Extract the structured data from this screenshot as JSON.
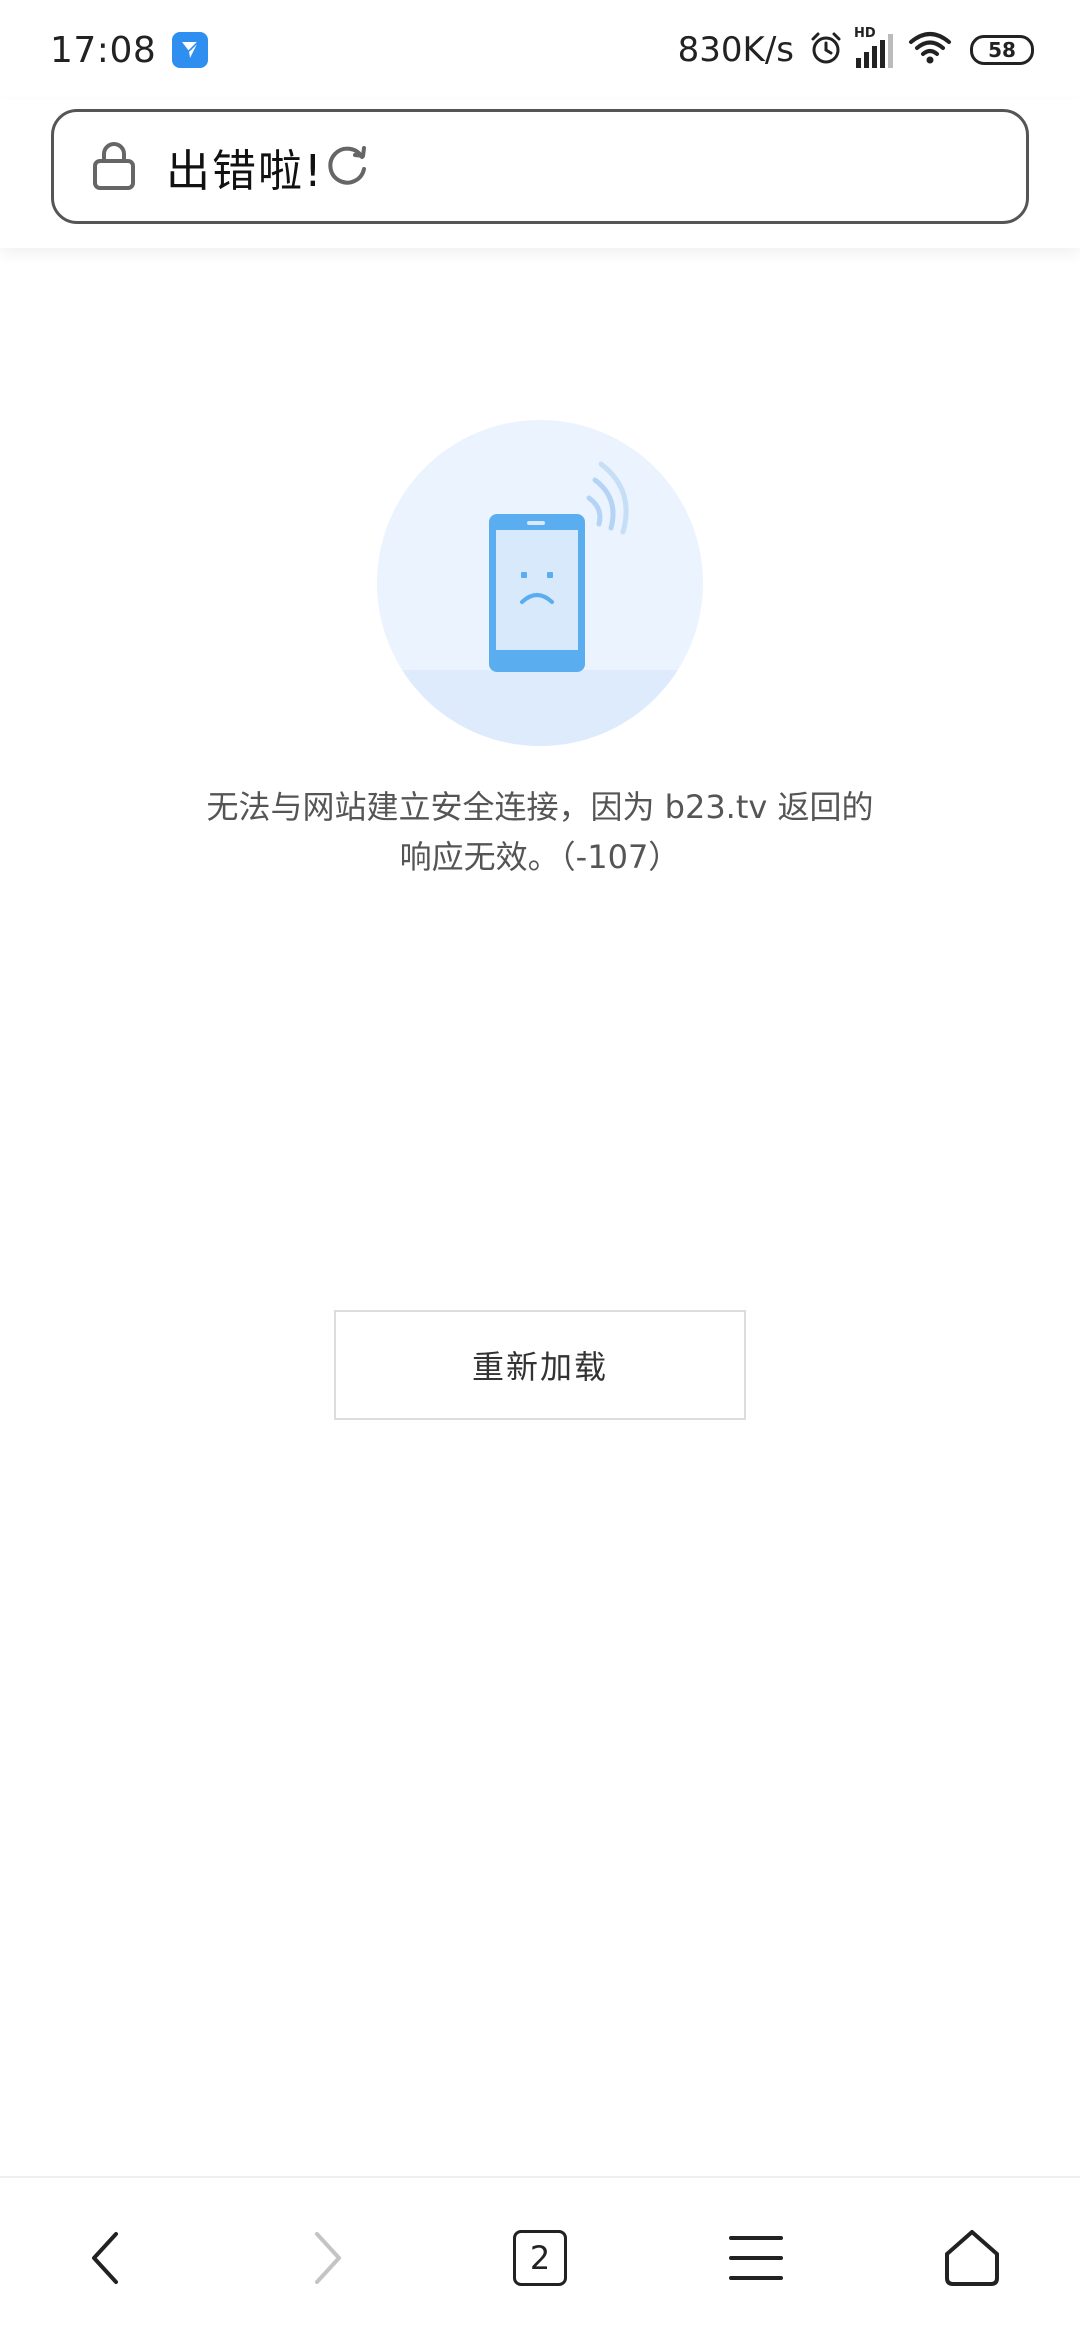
{
  "status_bar": {
    "time": "17:08",
    "network_speed": "830K/s",
    "signal_label": "HD",
    "battery": "58"
  },
  "address_bar": {
    "title": "出错啦!"
  },
  "error": {
    "message": "无法与网站建立安全连接，因为 b23.tv 返回的响应无效。（-107）",
    "reload_label": "重新加载"
  },
  "bottom_nav": {
    "tab_count": "2"
  },
  "colors": {
    "accent_blue": "#5aaef0",
    "circle_bg": "#eaf3fe",
    "status_icon": "#2f8ff0"
  }
}
